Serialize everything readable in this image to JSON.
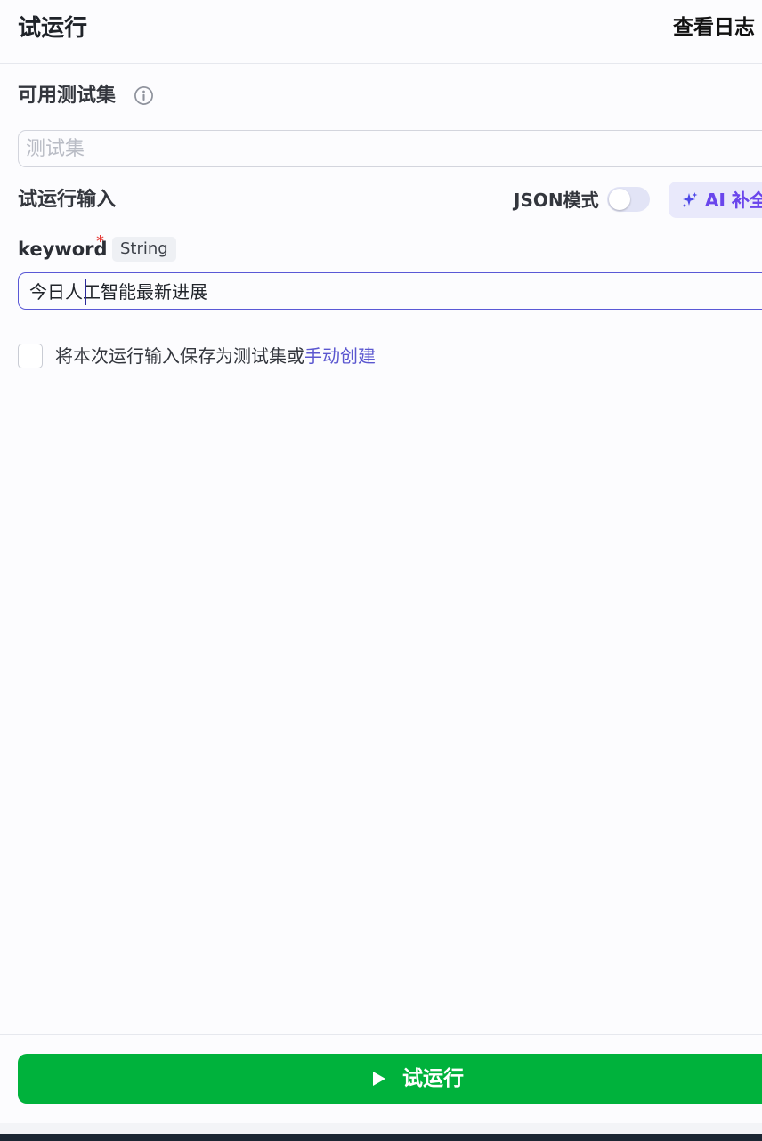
{
  "header": {
    "title": "试运行",
    "view_log": "查看日志"
  },
  "testset": {
    "label": "可用测试集",
    "placeholder": "测试集"
  },
  "run_input": {
    "label": "试运行输入",
    "json_mode_label": "JSON模式",
    "json_mode_on": false,
    "ai_button_label": "AI 补全"
  },
  "field": {
    "name": "keyword",
    "required_mark": "*",
    "type": "String",
    "value": "今日人工智能最新进展"
  },
  "save": {
    "text": "将本次运行输入保存为测试集或",
    "link": "手动创建",
    "checked": false
  },
  "footer": {
    "run_button_label": "试运行"
  },
  "colors": {
    "primary_green": "#00b23c",
    "link_purple": "#5b57d0",
    "input_focus_border": "#5a58d6",
    "required_red": "#e53935"
  }
}
